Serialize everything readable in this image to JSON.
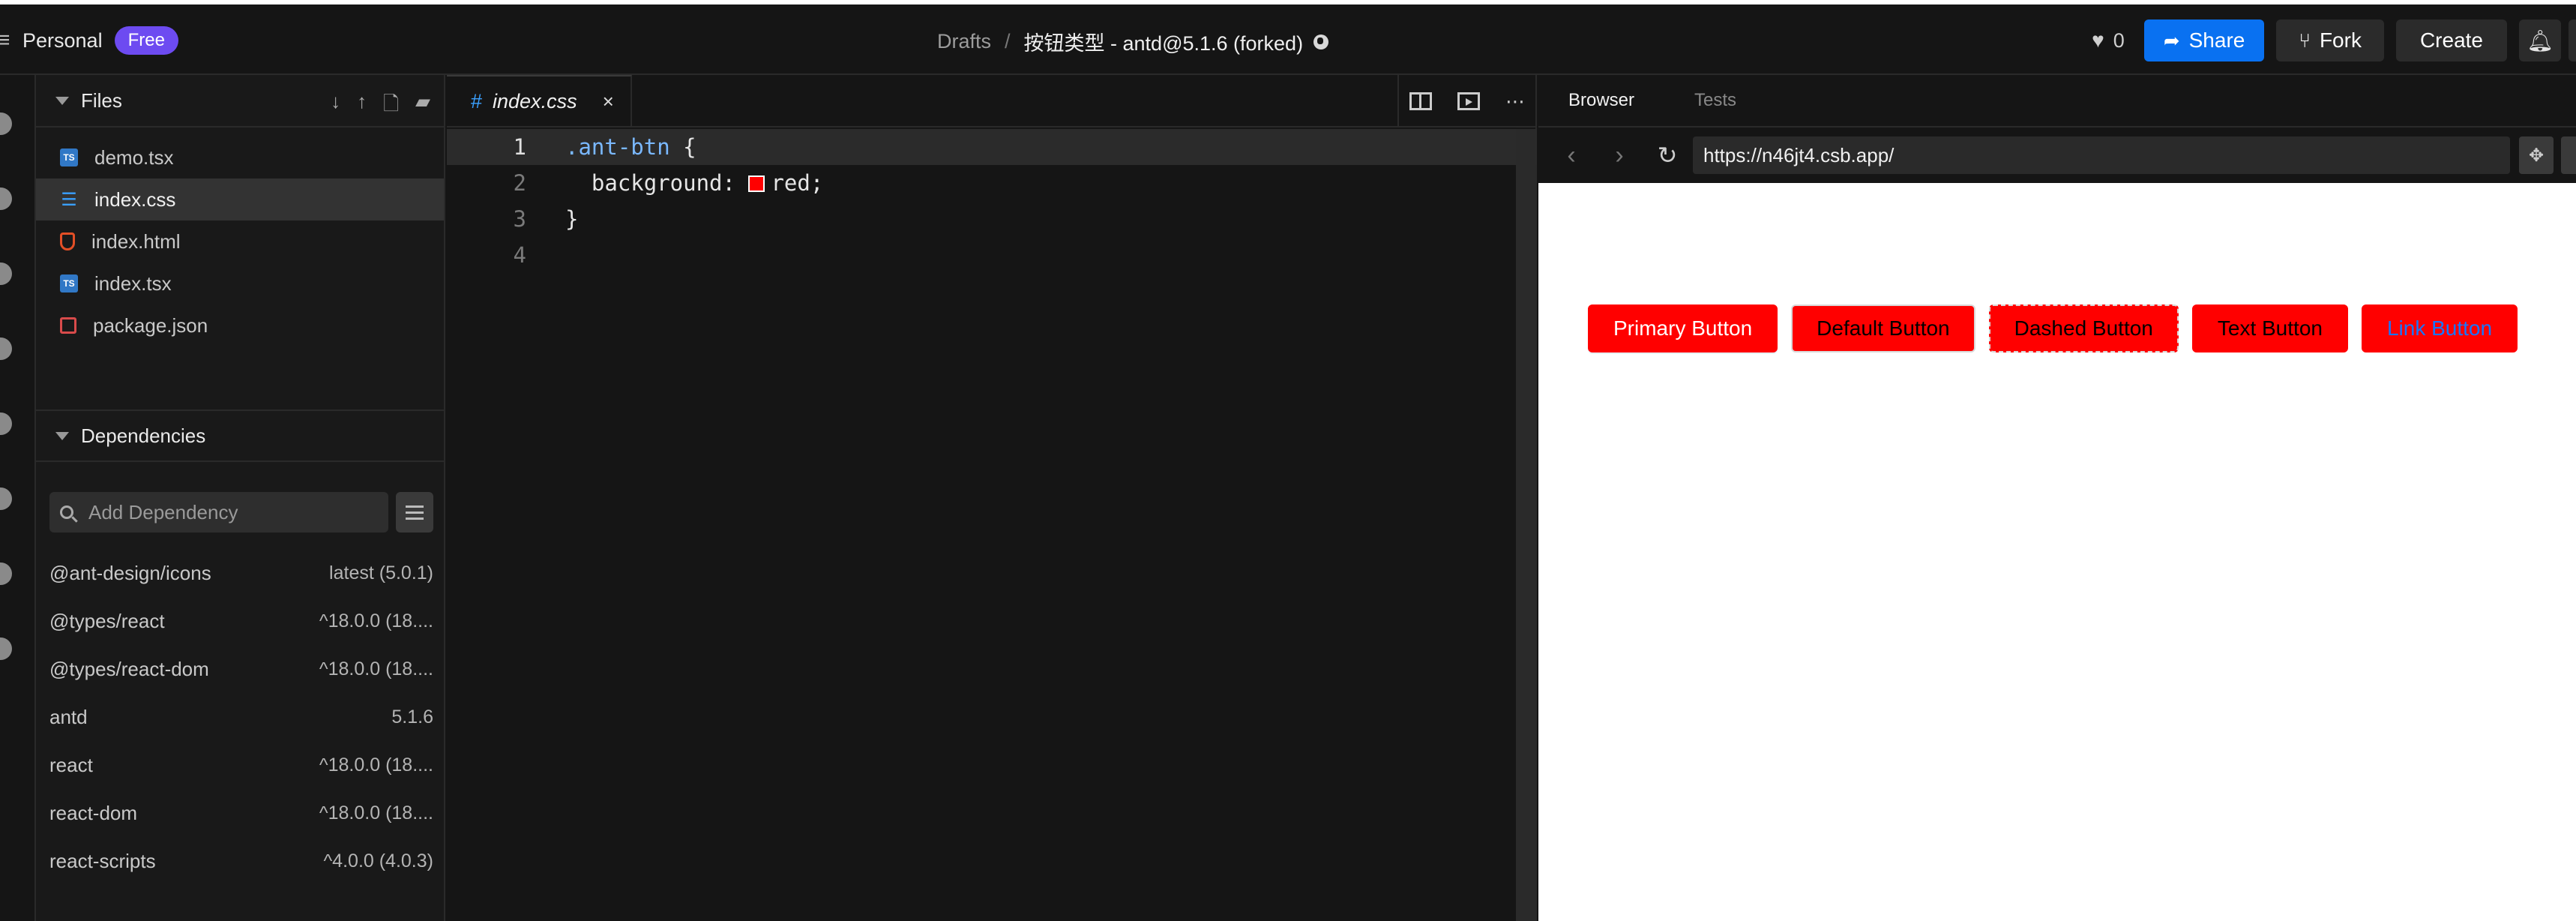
{
  "topbar": {
    "workspace": "Personal",
    "plan_badge": "Free",
    "breadcrumb_root": "Drafts",
    "breadcrumb_sep": "/",
    "sandbox_title": "按钮类型 - antd@5.1.6 (forked)",
    "likes": "0",
    "share_label": "Share",
    "fork_label": "Fork",
    "create_label": "Create"
  },
  "sidebar": {
    "files_title": "Files",
    "files": [
      {
        "name": "demo.tsx",
        "icon": "typescript-file-icon"
      },
      {
        "name": "index.css",
        "icon": "css-file-icon"
      },
      {
        "name": "index.html",
        "icon": "html-file-icon"
      },
      {
        "name": "index.tsx",
        "icon": "typescript-file-icon"
      },
      {
        "name": "package.json",
        "icon": "json-file-icon"
      }
    ],
    "active_file": "index.css",
    "dependencies_title": "Dependencies",
    "add_dependency_placeholder": "Add Dependency",
    "dependencies": [
      {
        "name": "@ant-design/icons",
        "version": "latest (5.0.1)"
      },
      {
        "name": "@types/react",
        "version": "^18.0.0 (18...."
      },
      {
        "name": "@types/react-dom",
        "version": "^18.0.0 (18...."
      },
      {
        "name": "antd",
        "version": "5.1.6"
      },
      {
        "name": "react",
        "version": "^18.0.0 (18...."
      },
      {
        "name": "react-dom",
        "version": "^18.0.0 (18...."
      },
      {
        "name": "react-scripts",
        "version": "^4.0.0 (4.0.3)"
      }
    ]
  },
  "editor": {
    "tab_label": "index.css",
    "tab_close": "×",
    "line_numbers": [
      "1",
      "2",
      "3",
      "4"
    ],
    "code": {
      "line1_selector": ".ant-btn",
      "line1_brace": " {",
      "line2_prop": "  background: ",
      "line2_value": "red;",
      "line3": "}",
      "line4": ""
    },
    "swatch_color": "#ff0000"
  },
  "browser": {
    "tabs": [
      "Browser",
      "Tests"
    ],
    "active_tab": "Browser",
    "url": "https://n46jt4.csb.app/",
    "buttons": [
      "Primary Button",
      "Default Button",
      "Dashed Button",
      "Text Button",
      "Link Button"
    ]
  },
  "colors": {
    "accent_share": "#0971f1",
    "badge_purple": "#6d4bf1",
    "button_red": "#ff0000",
    "link_blue": "#1677ff"
  }
}
